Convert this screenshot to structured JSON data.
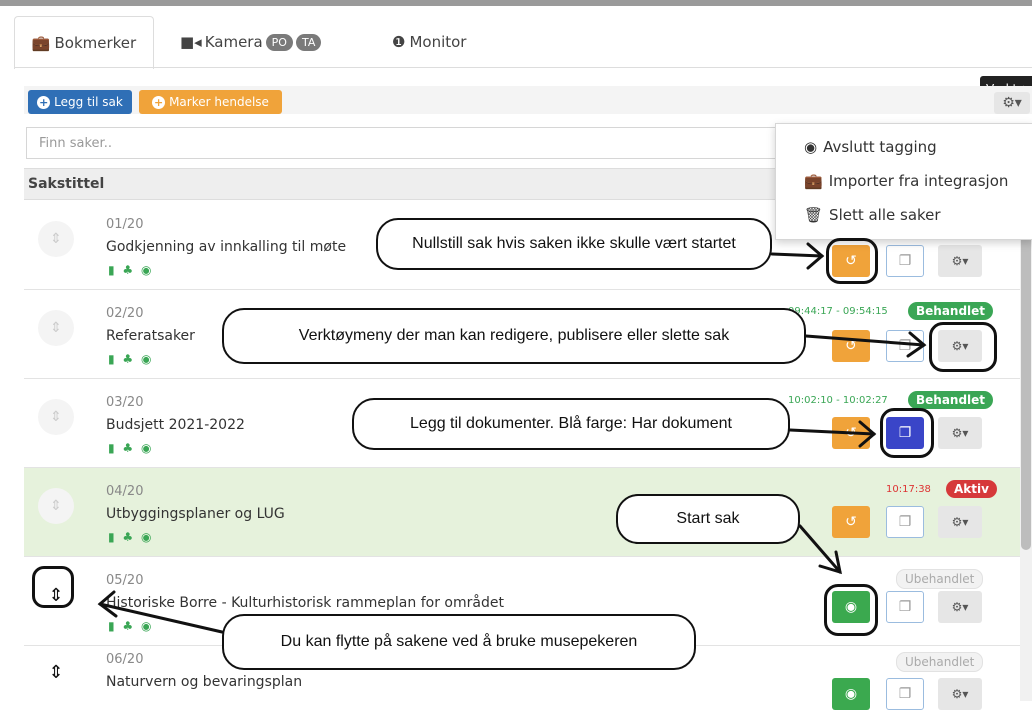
{
  "tabs": [
    {
      "label": "Bokmerker",
      "icon": "briefcase-icon"
    },
    {
      "label": "Kamera",
      "icon": "video-camera-icon",
      "badges": [
        "PO",
        "TA"
      ]
    },
    {
      "label": "Monitor",
      "icon": "info-icon"
    }
  ],
  "tooltip": "Verktøy",
  "toolbar": {
    "add_case_label": "Legg til sak",
    "mark_event_label": "Marker hendelse",
    "add_icon": "+"
  },
  "search": {
    "placeholder": "Finn saker.."
  },
  "table": {
    "column_header": "Sakstittel"
  },
  "dropdown": {
    "items": [
      {
        "label": "Avslutt tagging",
        "icon": "stop-circle-icon"
      },
      {
        "label": "Importer fra integrasjon",
        "icon": "briefcase-icon"
      },
      {
        "label": "Slett alle saker",
        "icon": "trash-icon"
      }
    ]
  },
  "rows": [
    {
      "number": "01/20",
      "title": "Godkjenning av innkalling til møte",
      "timer": "",
      "status": ""
    },
    {
      "number": "02/20",
      "title": "Referatsaker",
      "timer": "09:44:17 - 09:54:15",
      "status": "Behandlet"
    },
    {
      "number": "03/20",
      "title": "Budsjett 2021-2022",
      "timer": "10:02:10 - 10:02:27",
      "status": "Behandlet"
    },
    {
      "number": "04/20",
      "title": "Utbyggingsplaner og LUG",
      "timer": "10:17:38",
      "status": "Aktiv"
    },
    {
      "number": "05/20",
      "title": "Historiske Borre - Kulturhistorisk rammeplan for området",
      "timer": "",
      "status": "Ubehandlet"
    },
    {
      "number": "06/20",
      "title": "Naturvern og bevaringsplan",
      "timer": "",
      "status": "Ubehandlet"
    }
  ],
  "glyphs": {
    "reset": "↺",
    "doc": "❐",
    "play": "◉",
    "gear": "⚙▾",
    "handle": "⇕",
    "row_icons": "▮ ♣ ◉"
  },
  "callouts": {
    "reset": "Nullstill sak hvis saken ikke skulle vært startet",
    "tools": "Verktøymeny der man kan redigere, publisere eller slette sak",
    "documents": "Legg til dokumenter. Blå farge: Har dokument",
    "start": "Start sak",
    "move": "Du kan flytte på sakene ved å bruke musepekeren"
  },
  "colors": {
    "primary": "#2f6fb6",
    "warning": "#f0a33a",
    "success": "#3aa655",
    "danger": "#d6393a",
    "doc_blue": "#3a45c8",
    "active_row": "#e6f2dc"
  }
}
